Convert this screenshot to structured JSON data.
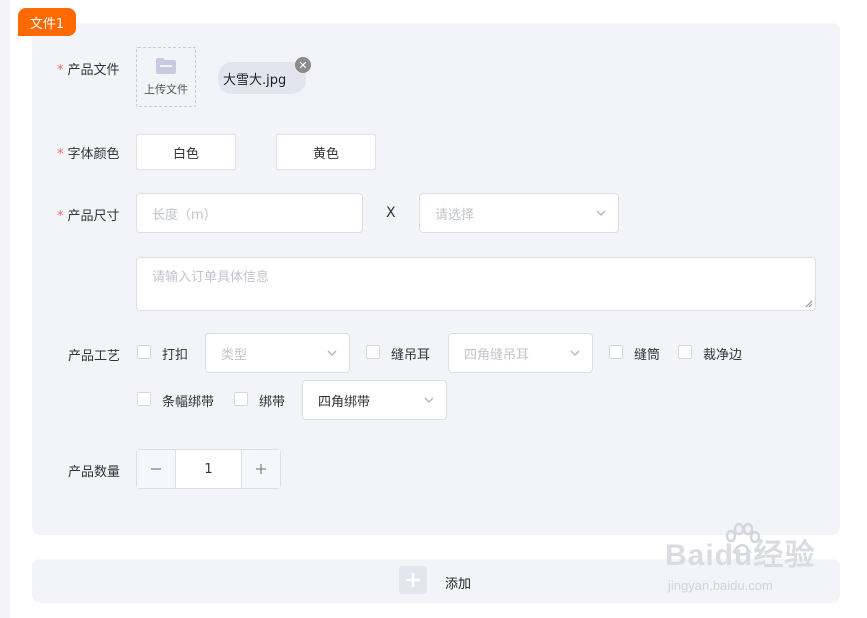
{
  "file_tag": "文件1",
  "form": {
    "product_file": {
      "label": "产品文件",
      "upload_label": "上传文件",
      "uploaded_file": "大雪大.jpg"
    },
    "font_color": {
      "label": "字体颜色",
      "options": [
        "白色",
        "黄色"
      ]
    },
    "product_size": {
      "label": "产品尺寸",
      "length_placeholder": "长度（m）",
      "separator": "X",
      "select_placeholder": "请选择"
    },
    "order_info": {
      "placeholder": "请输入订单具体信息"
    },
    "process": {
      "label": "产品工艺",
      "items": [
        {
          "label": "打扣",
          "select_placeholder": "类型"
        },
        {
          "label": "缝吊耳",
          "select_placeholder": "四角缝吊耳"
        },
        {
          "label": "缝筒"
        },
        {
          "label": "裁净边"
        },
        {
          "label": "条幅绑带"
        },
        {
          "label": "绑带",
          "select_value": "四角绑带"
        }
      ]
    },
    "quantity": {
      "label": "产品数量",
      "value": "1"
    }
  },
  "add_button": {
    "label": "添加"
  },
  "watermark": {
    "main": "Baidu经验",
    "sub": "jingyan.baidu.com"
  },
  "colors": {
    "accent": "#ff6a00",
    "panel_bg": "#f3f4f8",
    "required": "#f56c6c"
  },
  "icons": [
    "folder-icon",
    "close-icon",
    "chevron-down-icon",
    "minus-icon",
    "plus-icon"
  ]
}
